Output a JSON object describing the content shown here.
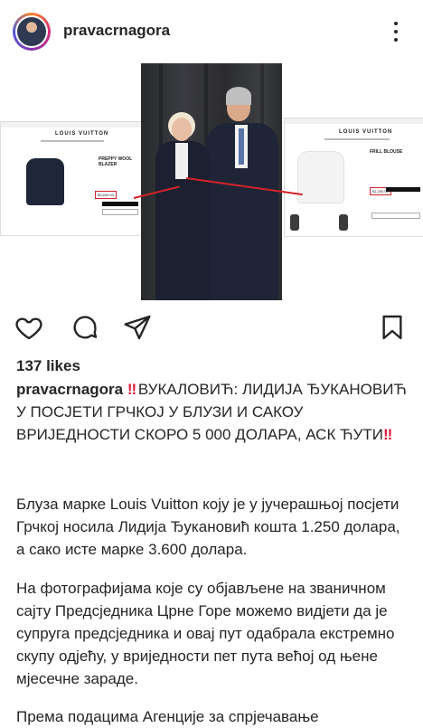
{
  "post": {
    "username": "pravacrnagora",
    "likes": "137 likes",
    "caption_headline": " ВУКАЛОВИЋ: ЛИДИЈА ЂУКАНОВИЋ У ПОСЈЕТИ ГРЧКОЈ У БЛУЗИ И САКОУ ВРИЈЕДНОСТИ СКОРО 5 000 ДОЛАРА, АСК ЋУТИ",
    "emoji_mark": "‼",
    "paragraph_1": "Блуза марке Louis Vuitton коју је у јучерашњој посјети Грчкој носила Лидија Ђукановић кошта 1.250 долара, а сако исте марке 3.600 долара.",
    "paragraph_2": "На фотографијама које су објављене на званичном сајту Предсједника Црне Горе можемо видјети да је супруга предсједника и овај пут одабрала екстремно скупу одјећу, у вриједности пет пута већој од њене мјесечне зараде.",
    "paragraph_3": "Према подацима Агенције за спрјечавање"
  },
  "media": {
    "left_brand": "LOUIS VUITTON",
    "left_item_title": "PREPPY WOOL BLAZER",
    "left_price": "$3,600.00",
    "right_brand": "LOUIS VUITTON",
    "right_item_title": "FRILL BLOUSE",
    "right_price": "$1,250.00",
    "highlight_color": "#d2232a"
  },
  "icons": {
    "like": "heart-icon",
    "comment": "comment-icon",
    "share": "send-icon",
    "save": "bookmark-icon",
    "more": "more-vertical-icon"
  }
}
